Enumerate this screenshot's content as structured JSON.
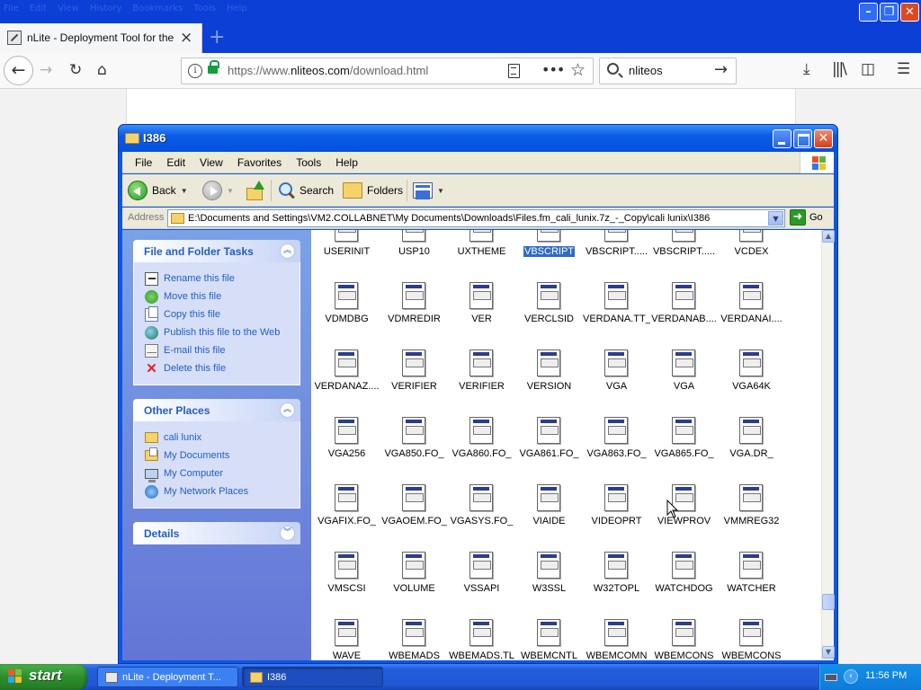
{
  "firefox": {
    "menu": [
      "File",
      "Edit",
      "View",
      "History",
      "Bookmarks",
      "Tools",
      "Help"
    ],
    "tab_title": "nLite - Deployment Tool for the bo",
    "url_prefix": "https://www.",
    "url_host": "nliteos.com",
    "url_path": "/download.html",
    "search_value": "nliteos"
  },
  "explorer": {
    "title": "I386",
    "menu": [
      "File",
      "Edit",
      "View",
      "Favorites",
      "Tools",
      "Help"
    ],
    "toolbar": {
      "back": "Back",
      "search": "Search",
      "folders": "Folders"
    },
    "address_label": "Address",
    "address_path": "E:\\Documents and Settings\\VM2.COLLABNET\\My Documents\\Downloads\\Files.fm_cali_lunix.7z_-_Copy\\cali lunix\\I386",
    "go_label": "Go",
    "tasks": {
      "file_folder_title": "File and Folder Tasks",
      "file_folder_items": [
        "Rename this file",
        "Move this file",
        "Copy this file",
        "Publish this file to the Web",
        "E-mail this file",
        "Delete this file"
      ],
      "other_places_title": "Other Places",
      "other_places_items": [
        "cali lunix",
        "My Documents",
        "My Computer",
        "My Network Places"
      ],
      "details_title": "Details"
    },
    "files": [
      "USERINIT",
      "USP10",
      "UXTHEME",
      "VBSCRIPT",
      "VBSCRIPT.....",
      "VBSCRIPT.....",
      "VCDEX",
      "VDMDBG",
      "VDMREDIR",
      "VER",
      "VERCLSID",
      "VERDANA.TT_",
      "VERDANAB....",
      "VERDANAI....",
      "VERDANAZ....",
      "VERIFIER",
      "VERIFIER",
      "VERSION",
      "VGA",
      "VGA",
      "VGA64K",
      "VGA256",
      "VGA850.FO_",
      "VGA860.FO_",
      "VGA861.FO_",
      "VGA863.FO_",
      "VGA865.FO_",
      "VGA.DR_",
      "VGAFIX.FO_",
      "VGAOEM.FO_",
      "VGASYS.FO_",
      "VIAIDE",
      "VIDEOPRT",
      "VIEWPROV",
      "VMMREG32",
      "VMSCSI",
      "VOLUME",
      "VSSAPI",
      "W3SSL",
      "W32TOPL",
      "WATCHDOG",
      "WATCHER",
      "WAVE",
      "WBEMADS",
      "WBEMADS.TL",
      "WBEMCNTL",
      "WBEMCOMN",
      "WBEMCONS",
      "WBEMCONS"
    ],
    "selected_file": "VBSCRIPT"
  },
  "taskbar": {
    "start": "start",
    "tasks": [
      "nLite - Deployment T...",
      "I386"
    ],
    "clock": "11:56 PM"
  }
}
